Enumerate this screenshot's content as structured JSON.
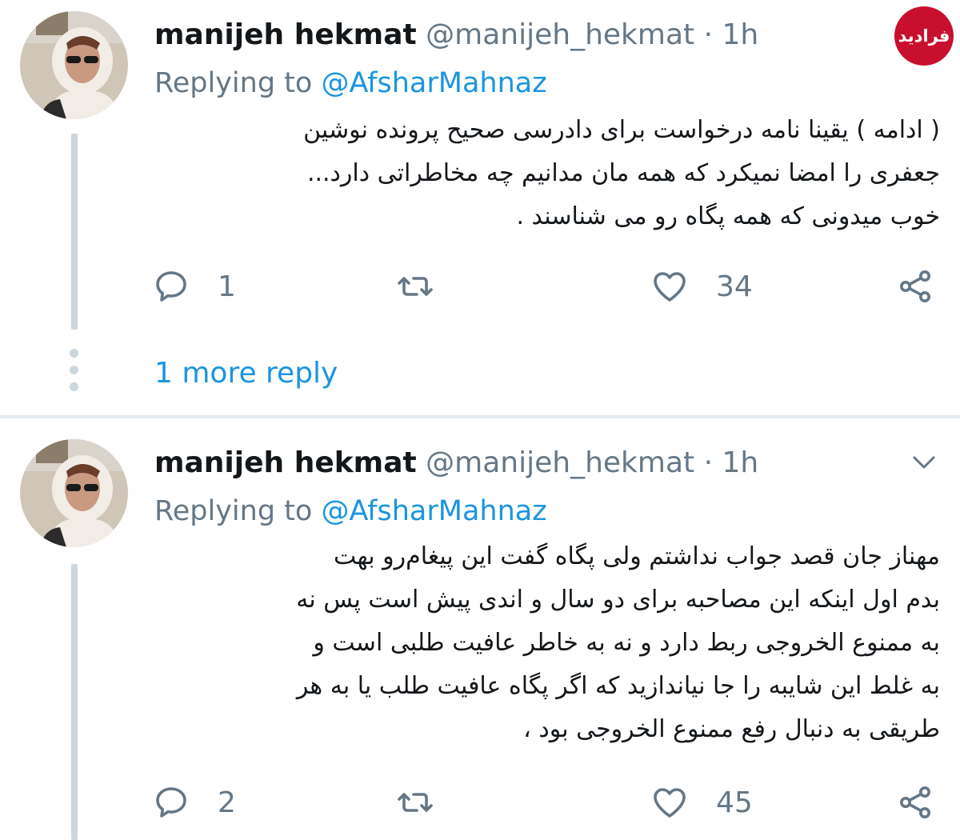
{
  "watermark_logo": {
    "text": "فرادید"
  },
  "tweets": [
    {
      "author_name": "manijeh hekmat",
      "handle": "@manijeh_hekmat",
      "separator": "·",
      "time": "1h",
      "replying_prefix": "Replying to",
      "replying_mention": "@AfsharMahnaz",
      "body_lines": [
        "( ادامه ) یقینا نامه درخواست برای دادرسی صحیح پرونده نوشین",
        "جعفری را امضا نمیکرد که همه مان مدانیم چه مخاطراتی دارد...",
        "خوب میدونی که همه پگاه رو می شناسند ."
      ],
      "reply_count": "1",
      "retweet_count": "",
      "like_count": "34",
      "more_replies_link": "1 more reply"
    },
    {
      "author_name": "manijeh hekmat",
      "handle": "@manijeh_hekmat",
      "separator": "·",
      "time": "1h",
      "replying_prefix": "Replying to",
      "replying_mention": "@AfsharMahnaz",
      "body_lines": [
        "مهناز جان قصد جواب نداشتم ولی پگاه گفت این پیغام‌رو بهت",
        "بدم اول اینکه این مصاحبه برای دو سال و اندی پیش است پس نه",
        "به ممنوع الخروجی ربط دارد و نه به خاطر عافیت طلبی است و",
        "به غلط این شایبه را جا نیاندازید که اگر پگاه عافیت طلب یا به هر",
        "طریقی به دنبال رفع ممنوع الخروجی بود ،"
      ],
      "reply_count": "2",
      "retweet_count": "",
      "like_count": "45"
    }
  ],
  "colors": {
    "link": "#1b95e0",
    "secondary_text": "#657786",
    "primary_text": "#14171a",
    "thread_line": "#ccd6dd",
    "logo": "#c8102e"
  }
}
